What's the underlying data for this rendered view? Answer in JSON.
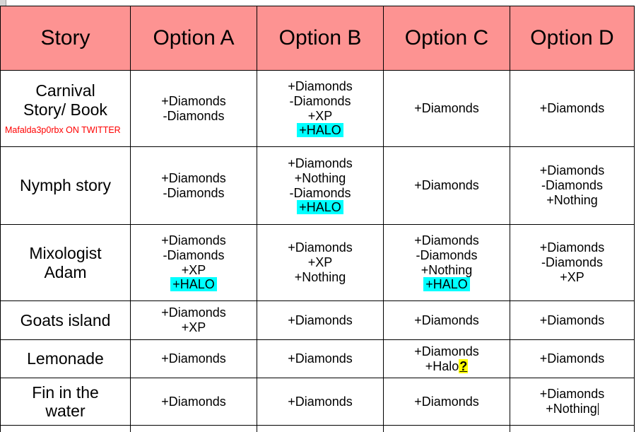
{
  "table": {
    "headers": [
      {
        "label": "Story"
      },
      {
        "label": "Option A"
      },
      {
        "label": "Option B"
      },
      {
        "label": "Option C"
      },
      {
        "label": "Option D"
      }
    ],
    "rows": [
      {
        "story": "Carnival\nStory/ Book",
        "story_line1": "Carnival",
        "story_line2": "Story/ Book",
        "watermark": "Mafalda3p0rbx ON TWITTER",
        "option_a": [
          "+Diamonds",
          "-Diamonds"
        ],
        "option_b": [
          "+Diamonds",
          "-Diamonds",
          "+XP",
          "+HALO"
        ],
        "option_b_highlight": "+HALO",
        "option_c": [
          "+Diamonds"
        ],
        "option_d": [
          "+Diamonds"
        ]
      },
      {
        "story_line1": "Nymph story",
        "story_line2": "",
        "option_a": [
          "+Diamonds",
          "-Diamonds"
        ],
        "option_b": [
          "+Diamonds",
          "+Nothing",
          "-Diamonds",
          "+HALO"
        ],
        "option_b_highlight": "+HALO",
        "option_c": [
          "+Diamonds"
        ],
        "option_d": [
          "+Diamonds",
          "-Diamonds",
          "+Nothing"
        ]
      },
      {
        "story_line1": "Mixologist",
        "story_line2": "Adam",
        "option_a": [
          "+Diamonds",
          "-Diamonds",
          "+XP",
          "+HALO"
        ],
        "option_a_highlight": "+HALO",
        "option_b": [
          "+Diamonds",
          "+XP",
          "+Nothing"
        ],
        "option_c": [
          "+Diamonds",
          "-Diamonds",
          "+Nothing",
          "+HALO"
        ],
        "option_c_highlight": "+HALO",
        "option_d": [
          "+Diamonds",
          "-Diamonds",
          "+XP"
        ]
      },
      {
        "story_line1": "Goats island",
        "story_line2": "",
        "option_a": [
          "+Diamonds",
          "+XP"
        ],
        "option_b": [
          "+Diamonds"
        ],
        "option_c": [
          "+Diamonds"
        ],
        "option_d": [
          "+Diamonds"
        ]
      },
      {
        "story_line1": "Lemonade",
        "story_line2": "",
        "option_a": [
          "+Diamonds"
        ],
        "option_b": [
          "+Diamonds"
        ],
        "option_c": [
          "+Diamonds",
          "+Halo?"
        ],
        "option_c_halo_text": "+Halo",
        "option_c_halo_marker": "?",
        "option_d": [
          "+Diamonds"
        ]
      },
      {
        "story_line1": "Fin in the",
        "story_line2": "water",
        "option_a": [
          "+Diamonds"
        ],
        "option_b": [
          "+Diamonds"
        ],
        "option_c": [
          "+Diamonds"
        ],
        "option_d": [
          "+Diamonds",
          "+Nothing"
        ],
        "option_d_has_caret": true
      }
    ]
  },
  "colors": {
    "header_pink": "#fd9392",
    "highlight_cyan": "#00ffff",
    "highlight_yellow": "#ffff00",
    "watermark_red": "#ff0000",
    "grid_line": "#000000"
  }
}
